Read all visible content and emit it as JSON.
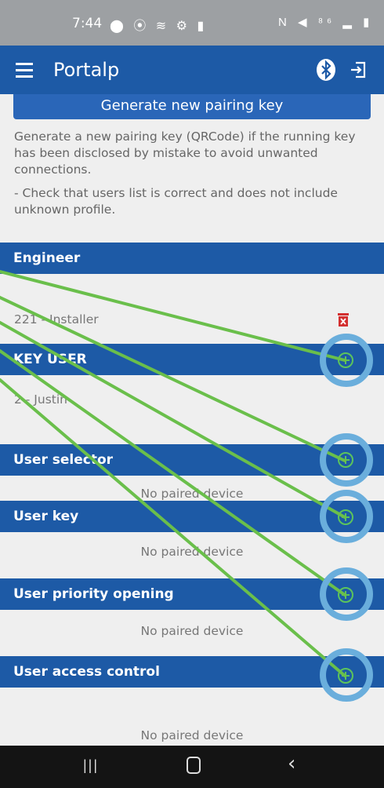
{
  "status_bar": {
    "time": "7:44",
    "left_icons": "⬤ ⦿ ≋ ⚙ ▮",
    "right_icons": "N ◀ ⁸⁶ ▂ ▮"
  },
  "app_bar": {
    "title": "Portalp",
    "icons": [
      "menu-icon",
      "bluetooth-icon",
      "logout-icon"
    ]
  },
  "generate_button": {
    "label": "Generate new pairing key"
  },
  "info": {
    "paragraph1": "Generate a new pairing key (QRCode) if the running key has been disclosed by mistake to avoid unwanted connections.",
    "paragraph2": "- Check that users list is correct and does not include unknown profile."
  },
  "sections": [
    {
      "title": "Engineer",
      "rows": [
        "221 - Installer"
      ],
      "empty_text": ""
    },
    {
      "title": "KEY USER",
      "rows": [
        "2 - Justin"
      ],
      "empty_text": ""
    },
    {
      "title": "User selector",
      "rows": [],
      "empty_text": "No paired device"
    },
    {
      "title": "User key",
      "rows": [],
      "empty_text": "No paired device"
    },
    {
      "title": "User priority opening",
      "rows": [],
      "empty_text": "No paired device"
    },
    {
      "title": "User access control",
      "rows": [],
      "empty_text": "No paired device"
    }
  ],
  "colors": {
    "primary": "#1d5aa6",
    "annotation_ring": "#6aaedc",
    "annotation_line": "#6abf4b",
    "delete": "#d32f2f",
    "add": "#5cc45c"
  },
  "nav_bar": {
    "recents": "|||",
    "back": "‹"
  }
}
